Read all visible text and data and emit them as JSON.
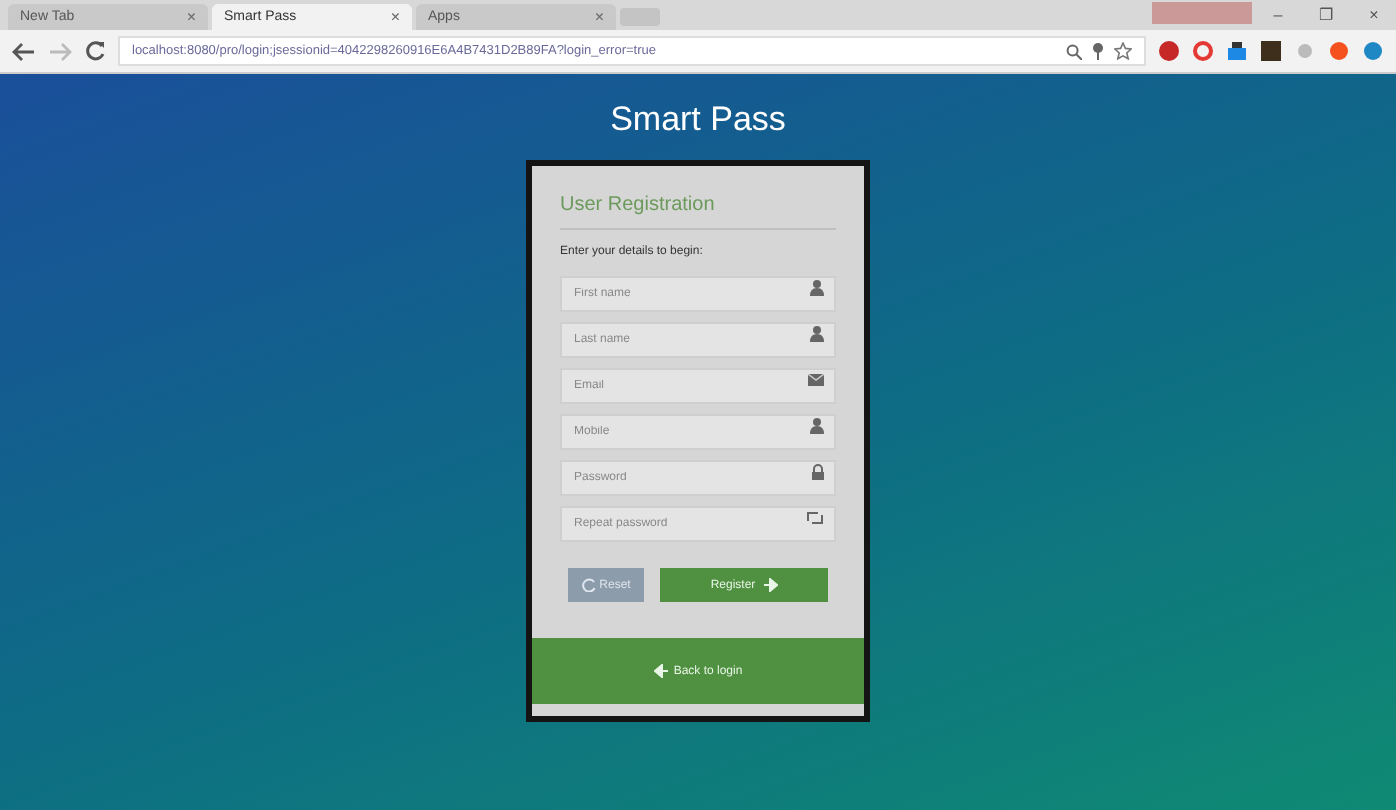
{
  "tabs": [
    {
      "label": "New Tab",
      "close": "×",
      "selected": false
    },
    {
      "label": "Smart Pass",
      "close": "×",
      "selected": true
    },
    {
      "label": "Apps",
      "close": "×",
      "selected": false
    }
  ],
  "address_bar": {
    "url": "localhost:8080/pro/login;jsessionid=4042298260916E6A4B7431D2B89FA?login_error=true"
  },
  "window_controls": [
    "–",
    "❐",
    "×"
  ],
  "page": {
    "title": "Smart Pass",
    "form": {
      "heading": "User Registration",
      "instruction": "Enter your details to begin:",
      "fields": [
        {
          "placeholder": "First name",
          "kind": "person"
        },
        {
          "placeholder": "Last name",
          "kind": "person"
        },
        {
          "placeholder": "Email",
          "kind": "email"
        },
        {
          "placeholder": "Mobile",
          "kind": "person"
        },
        {
          "placeholder": "Password",
          "kind": "secret"
        },
        {
          "placeholder": "Repeat password",
          "kind": "repeat"
        }
      ],
      "reset": "Reset",
      "register": "Register",
      "back": "Back to login"
    }
  }
}
